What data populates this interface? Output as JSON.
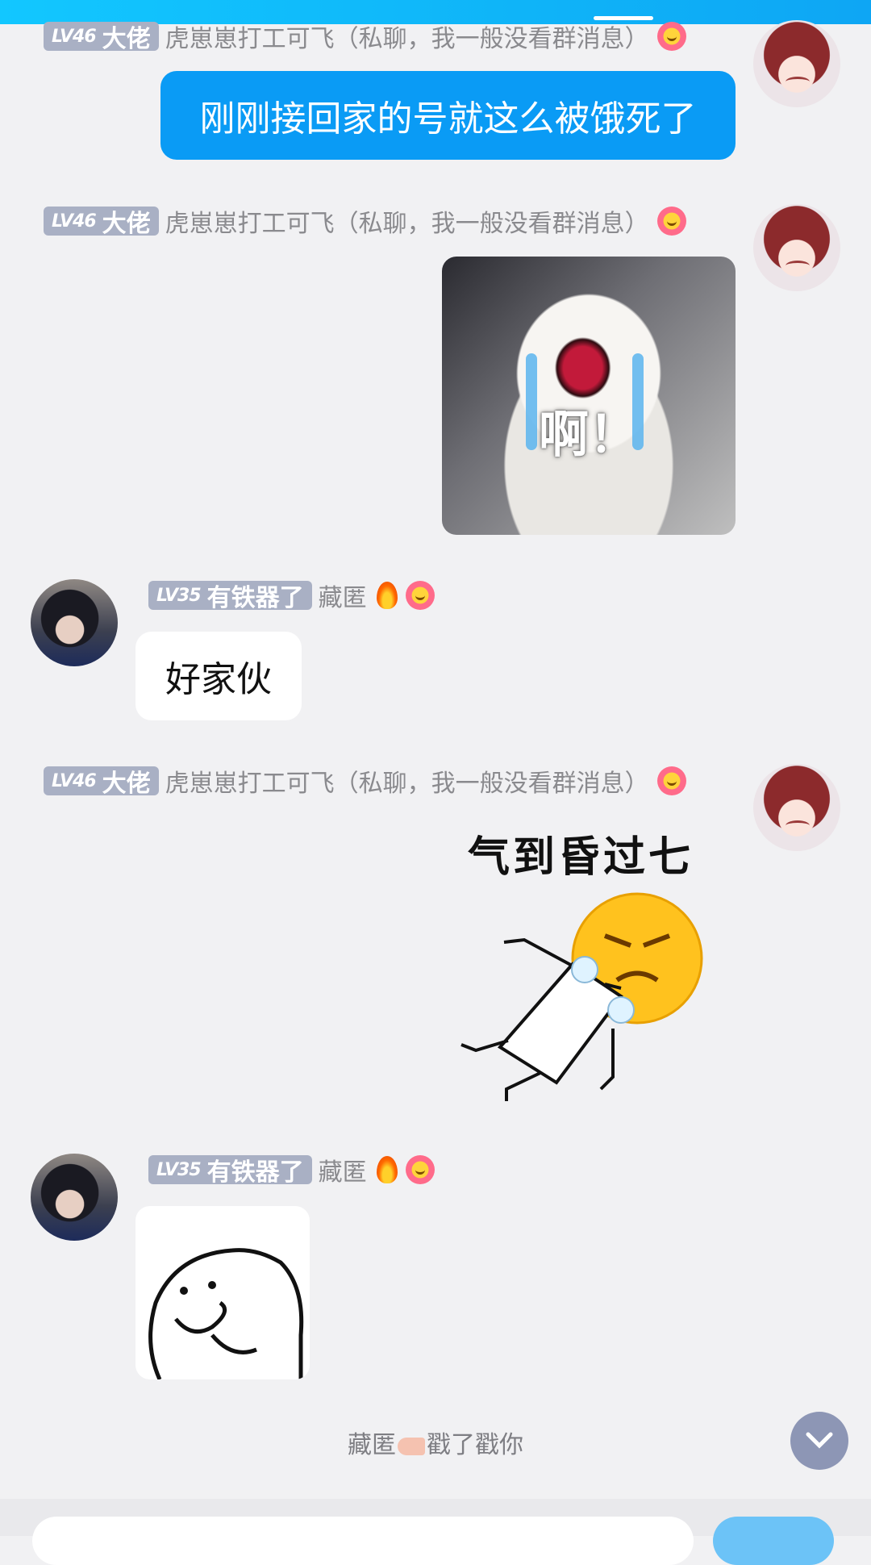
{
  "messages": [
    {
      "sender": "me",
      "level": "LV46",
      "title": "大佬",
      "nickname": "虎崽崽打工可飞（私聊，我一般没看群消息）",
      "type": "text",
      "text": "刚刚接回家的号就这么被饿死了"
    },
    {
      "sender": "me",
      "level": "LV46",
      "title": "大佬",
      "nickname": "虎崽崽打工可飞（私聊，我一般没看群消息）",
      "type": "sticker",
      "sticker_caption": "啊！"
    },
    {
      "sender": "other",
      "level": "LV35",
      "title": "有铁器了",
      "nickname": "藏匿",
      "type": "text",
      "text": "好家伙"
    },
    {
      "sender": "me",
      "level": "LV46",
      "title": "大佬",
      "nickname": "虎崽崽打工可飞（私聊，我一般没看群消息）",
      "type": "sticker",
      "sticker_caption": "气到昏过七"
    },
    {
      "sender": "other",
      "level": "LV35",
      "title": "有铁器了",
      "nickname": "藏匿",
      "type": "sticker"
    }
  ],
  "system_tip": {
    "actor": "藏匿",
    "action": "戳了戳你"
  },
  "colors": {
    "accent": "#0a9bf5",
    "badge": "#a9b0c4",
    "background": "#f1f1f3"
  },
  "icons": {
    "scroll_down": "chevron-down-icon",
    "flower": "flower-emoji-icon",
    "fire": "fire-emoji-icon",
    "pointer": "pointing-hand-icon"
  }
}
